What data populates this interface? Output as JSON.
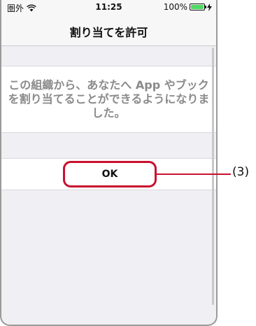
{
  "status_bar": {
    "carrier": "圏外",
    "time": "11:25",
    "battery_percent": "100%",
    "battery_level": 1.0,
    "wifi_icon": "wifi-icon",
    "charging_icon": "bolt-icon"
  },
  "nav": {
    "title": "割り当てを許可"
  },
  "message": {
    "text": "この組織から、あなたへ App やブックを割り当てることができるようになりました。"
  },
  "actions": {
    "ok_label": "OK"
  },
  "callout": {
    "label": "(3)"
  },
  "colors": {
    "highlight": "#c8102e",
    "background": "#efeff4",
    "battery_fill": "#4cd964"
  }
}
